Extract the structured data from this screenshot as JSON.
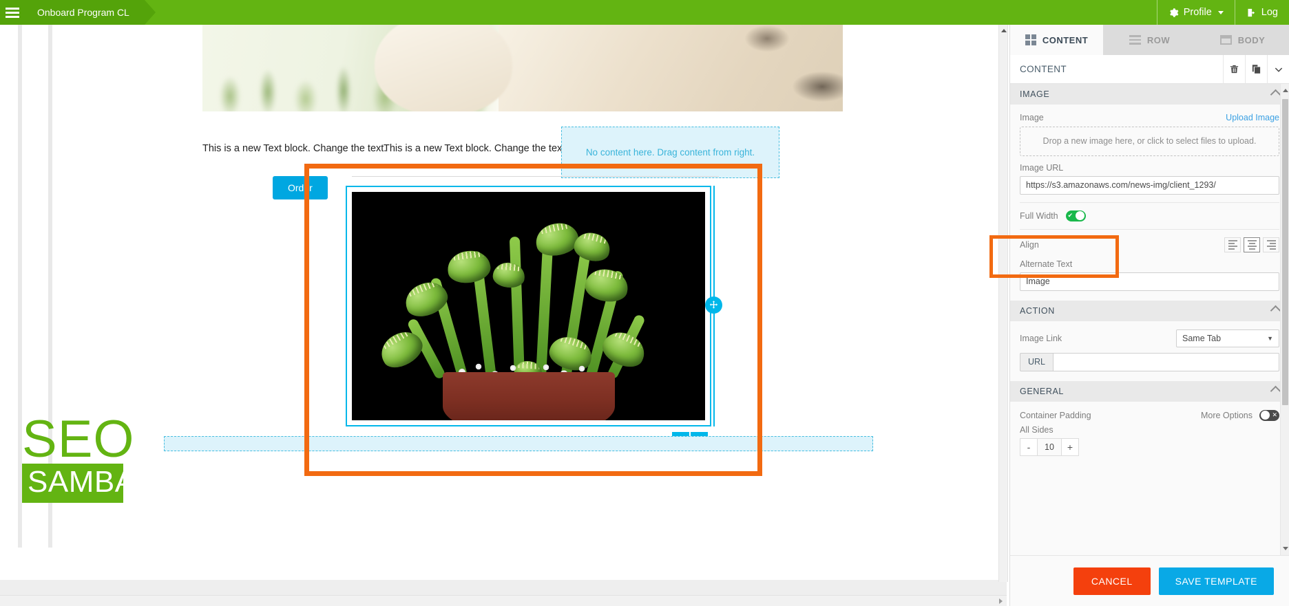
{
  "topbar": {
    "menu_icon": "hamburger-icon",
    "breadcrumb": "Onboard Program CL",
    "profile_label": "Profile",
    "profile_icon": "gear-icon",
    "logout_label": "Log",
    "logout_icon": "logout-icon",
    "background_color": "#63b412"
  },
  "canvas": {
    "hero_alt": "snow leopard photo",
    "text_block_1": "This is a new Text block. Change the text.",
    "text_block_2": "This is a new Text block. Change the text.",
    "empty_placeholder": "No content here. Drag content from right.",
    "order_button": "Order",
    "selected_image_alt": "venus flytrap plant in pot",
    "block_toolbar": {
      "delete_icon": "trash-icon",
      "duplicate_icon": "duplicate-icon",
      "move_icon": "move-handle-icon"
    },
    "logo_top": "SEO",
    "logo_bottom": "SAMBA",
    "logo_color": "#63b412",
    "selection_color": "#00b7ea",
    "highlight_color": "#f26a11"
  },
  "panel": {
    "tabs": [
      {
        "label": "CONTENT",
        "icon": "grid-icon",
        "active": true
      },
      {
        "label": "ROW",
        "icon": "rows-icon",
        "active": false
      },
      {
        "label": "BODY",
        "icon": "body-icon",
        "active": false
      }
    ],
    "header": {
      "title": "CONTENT",
      "delete_icon": "trash-icon",
      "duplicate_icon": "duplicate-icon",
      "collapse_icon": "chevron-down-icon"
    },
    "image_section": {
      "title": "IMAGE",
      "image_label": "Image",
      "upload_link": "Upload Image",
      "dropzone_text": "Drop a new image here, or click to select files to upload.",
      "image_url_label": "Image URL",
      "image_url_value": "https://s3.amazonaws.com/news-img/client_1293/",
      "full_width_label": "Full Width",
      "full_width_on": true,
      "align_label": "Align",
      "align_selected": "center",
      "align_options": [
        "left",
        "center",
        "right"
      ],
      "alternate_text_label": "Alternate Text",
      "alternate_text_value": "Image"
    },
    "action_section": {
      "title": "ACTION",
      "image_link_label": "Image Link",
      "image_link_value": "Same Tab",
      "url_label": "URL",
      "url_value": ""
    },
    "general_section": {
      "title": "GENERAL",
      "container_padding_label": "Container Padding",
      "more_options_label": "More Options",
      "more_options_on": false,
      "all_sides_label": "All Sides",
      "minus_label": "-",
      "padding_value": "10",
      "plus_label": "+"
    },
    "footer": {
      "cancel_label": "CANCEL",
      "save_label": "SAVE TEMPLATE",
      "cancel_color": "#f4400d",
      "save_color": "#09a9e6"
    }
  }
}
